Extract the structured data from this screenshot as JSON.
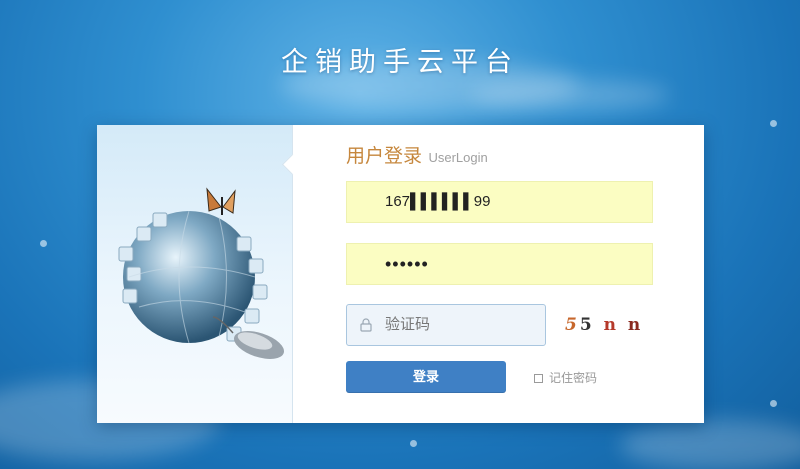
{
  "app": {
    "title": "企销助手云平台"
  },
  "login": {
    "heading_cn": "用户登录",
    "heading_en": "UserLogin",
    "username_value": "167▌▌▌▌▌▌99",
    "password_mask": "••••••",
    "captcha_placeholder": "验证码",
    "captcha_parts": [
      "5",
      "5",
      "n",
      "n"
    ],
    "login_button": "登录",
    "remember_label": "记住密码"
  },
  "icons": {
    "lock": "lock-icon",
    "checkbox": "checkbox-icon",
    "illustration": "globe-puzzle-illustration"
  },
  "colors": {
    "background": "#2f8fd0",
    "accent_button": "#3f80c5",
    "heading": "#c6873d",
    "autofill": "#fbfdc2"
  }
}
